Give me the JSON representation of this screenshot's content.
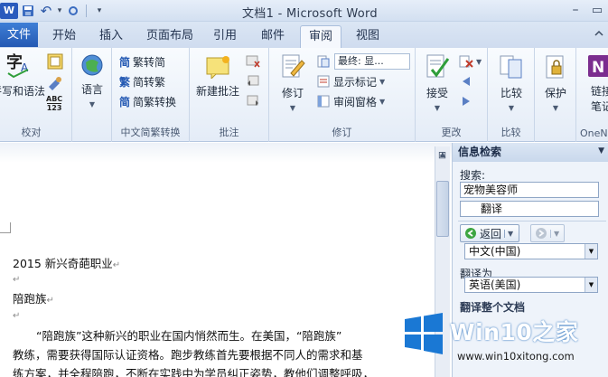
{
  "window": {
    "title": "文档1 - Microsoft Word",
    "minimize_glyph": "–",
    "restore_glyph": "▭"
  },
  "qat": {
    "app_logo": "W",
    "undo_glyph": "↶",
    "dropdown_glyph": "▾"
  },
  "tabs": {
    "file": "文件",
    "items": [
      "开始",
      "插入",
      "页面布局",
      "引用",
      "邮件",
      "审阅",
      "视图"
    ],
    "active": "审阅"
  },
  "ribbon": {
    "proofing": {
      "label": "校对",
      "spelling": "拼写和语法",
      "abc_glyph": "ABC",
      "count_glyph": "123"
    },
    "language": {
      "button": "语言"
    },
    "chinese_conversion": {
      "label": "中文简繁转换",
      "to_simplified": "繁转简",
      "to_traditional": "简转繁",
      "convert": "简繁转换"
    },
    "comments": {
      "label": "批注",
      "new_comment": "新建批注"
    },
    "tracking": {
      "label": "修订",
      "track_changes": "修订",
      "markup_combo": "最终: 显...",
      "show_markup": "显示标记",
      "review_pane": "审阅窗格"
    },
    "changes": {
      "label": "更改",
      "accept": "接受"
    },
    "compare": {
      "label": "比较",
      "button": "比较"
    },
    "protect": {
      "button": "保护"
    },
    "onenote": {
      "label": "OneN",
      "button_line1": "链接",
      "button_line2": "笔记"
    }
  },
  "document": {
    "heading": "2015 新兴奇葩职业",
    "subheading": "陪跑族",
    "para_line1": "“陪跑族”这种新兴的职业在国内悄然而生。在美国，“陪跑族”",
    "para_line2": "教练，需要获得国际认证资格。跑步教练首先要根据不同人的需求和基",
    "para_line3": "练方案，并全程陪跑，不断在实践中为学员纠正姿势，教他们调整呼吸，",
    "para_mark": "↵"
  },
  "research_pane": {
    "title": "信息检索",
    "search_label": "搜索:",
    "search_value": "宠物美容师",
    "translate_item": "翻译",
    "back_button": "返回",
    "from_language": "中文(中国)",
    "translate_to_label": "翻译为",
    "to_language": "英语(美国)",
    "more_line": "翻译整个文档"
  },
  "watermark": {
    "brand": "Win10之家",
    "url": "www.win10xitong.com"
  },
  "colors": {
    "accent_blue": "#2459b3",
    "watermark_blue": "#1a78d4"
  }
}
